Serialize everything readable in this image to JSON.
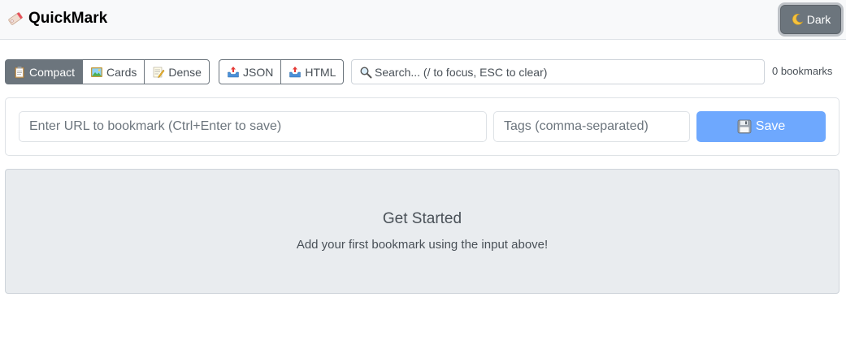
{
  "app": {
    "title": "QuickMark",
    "logo_icon": "bookmark-tag-icon"
  },
  "header": {
    "theme_button": {
      "label": "Dark",
      "icon": "moon-icon"
    }
  },
  "view_modes": [
    {
      "label": "Compact",
      "icon": "clipboard-icon",
      "active": true
    },
    {
      "label": "Cards",
      "icon": "picture-icon",
      "active": false
    },
    {
      "label": "Dense",
      "icon": "memo-icon",
      "active": false
    }
  ],
  "export": [
    {
      "label": "JSON",
      "icon": "outbox-icon"
    },
    {
      "label": "HTML",
      "icon": "outbox-icon"
    }
  ],
  "search": {
    "icon": "magnifier-icon",
    "placeholder": "Search... (/ to focus, ESC to clear)",
    "value": ""
  },
  "bookmark_count": "0 bookmarks",
  "form": {
    "url_placeholder": "Enter URL to bookmark (Ctrl+Enter to save)",
    "url_value": "",
    "tags_placeholder": "Tags (comma-separated)",
    "tags_value": "",
    "save_label": "Save",
    "save_icon": "floppy-disk-icon"
  },
  "empty_state": {
    "title": "Get Started",
    "message": "Add your first bookmark using the input above!"
  },
  "colors": {
    "primary_button": "#6ea8fe",
    "secondary_button": "#6c757d",
    "empty_state_bg": "#e9ecef"
  }
}
